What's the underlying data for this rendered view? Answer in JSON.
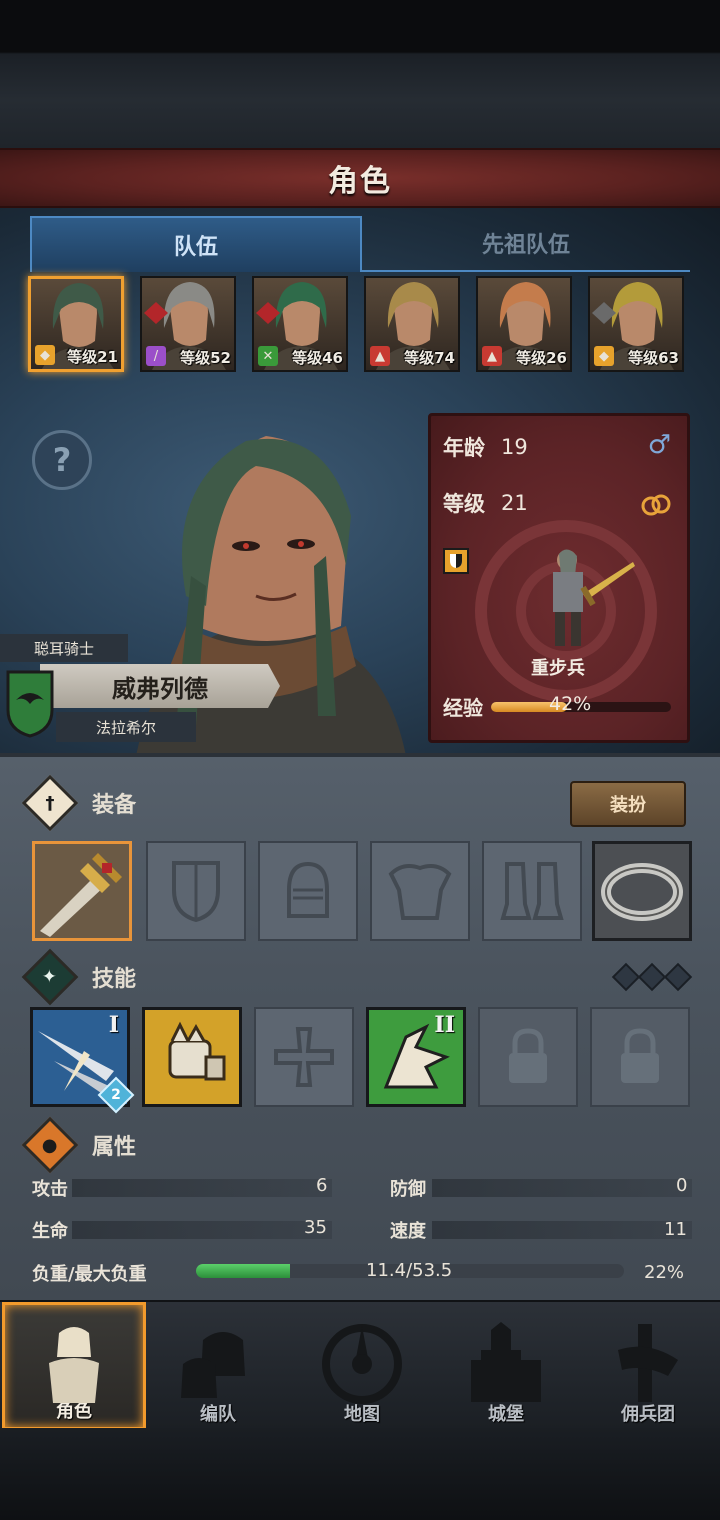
{
  "header": {
    "title": "角色"
  },
  "tabs": [
    {
      "label": "队伍",
      "active": true
    },
    {
      "label": "先祖队伍",
      "active": false
    }
  ],
  "roster": [
    {
      "level_label": "等级21",
      "class_icon": "shield-icon",
      "class_color": "#e7a22c",
      "faction_icon": "",
      "hair": "#3f5a48",
      "selected": true
    },
    {
      "level_label": "等级52",
      "class_icon": "staff-icon",
      "class_color": "#9b4fc9",
      "faction_icon": "red-knot-icon",
      "hair": "#8a8a86",
      "selected": false
    },
    {
      "level_label": "等级46",
      "class_icon": "bow-icon",
      "class_color": "#3a9a3a",
      "faction_icon": "red-knot-icon",
      "hair": "#2f6b4a",
      "selected": false
    },
    {
      "level_label": "等级74",
      "class_icon": "beast-icon",
      "class_color": "#c83a32",
      "faction_icon": "",
      "hair": "#a88a4a",
      "selected": false
    },
    {
      "level_label": "等级26",
      "class_icon": "beast-icon",
      "class_color": "#c83a32",
      "faction_icon": "",
      "hair": "#c47c4c",
      "selected": false
    },
    {
      "level_label": "等级63",
      "class_icon": "shield-icon",
      "class_color": "#e7a22c",
      "faction_icon": "grey-knot-icon",
      "hair": "#b39b3a",
      "selected": false
    }
  ],
  "character": {
    "title": "聪耳骑士",
    "name": "威弗列德",
    "house": "法拉希尔",
    "age_label": "年龄",
    "age": "19",
    "gender_icon": "male-icon",
    "level_label": "等级",
    "level": "21",
    "ring_icon": "wedding-rings-icon",
    "class_icon": "shield-icon",
    "unit_type": "重步兵",
    "xp_label": "经验",
    "xp_percent_text": "42%",
    "xp_fraction": 0.42
  },
  "equipment": {
    "title": "装备",
    "outfit_button": "装扮",
    "slots": [
      {
        "name": "weapon-slot",
        "icon": "ornate-sword-icon",
        "equipped": true
      },
      {
        "name": "offhand-slot",
        "icon": "shield-icon",
        "equipped": false
      },
      {
        "name": "helmet-slot",
        "icon": "helmet-icon",
        "equipped": false
      },
      {
        "name": "armor-slot",
        "icon": "chest-armor-icon",
        "equipped": false
      },
      {
        "name": "boots-slot",
        "icon": "boots-icon",
        "equipped": false
      },
      {
        "name": "ring-slot",
        "icon": "ring-icon",
        "equipped": true
      }
    ]
  },
  "skills": {
    "title": "技能",
    "slots": [
      {
        "icon": "blade-strike-icon",
        "rank": "I",
        "badge": "2",
        "color": "#2c5f93"
      },
      {
        "icon": "gauntlet-punch-icon",
        "rank": "",
        "badge": "",
        "color": "#d3a229"
      },
      {
        "icon": "cross-icon",
        "rank": "",
        "badge": "",
        "color": ""
      },
      {
        "icon": "charge-icon",
        "rank": "II",
        "badge": "",
        "color": "#3e9c3e"
      },
      {
        "icon": "lock-icon",
        "rank": "",
        "badge": "",
        "color": ""
      },
      {
        "icon": "lock-icon",
        "rank": "",
        "badge": "",
        "color": ""
      }
    ]
  },
  "attributes": {
    "title": "属性",
    "attack_label": "攻击",
    "attack": "6",
    "defense_label": "防御",
    "defense": "0",
    "health_label": "生命",
    "health": "35",
    "speed_label": "速度",
    "speed": "11",
    "load_label": "负重/最大负重",
    "load": "11.4/53.5",
    "load_percent": "22%",
    "load_fraction": 0.22
  },
  "nav": [
    {
      "label": "角色",
      "icon": "knight-icon",
      "active": true
    },
    {
      "label": "编队",
      "icon": "helmet-group-icon",
      "active": false
    },
    {
      "label": "地图",
      "icon": "compass-icon",
      "active": false
    },
    {
      "label": "城堡",
      "icon": "castle-icon",
      "active": false
    },
    {
      "label": "佣兵团",
      "icon": "banner-fist-icon",
      "active": false
    }
  ]
}
